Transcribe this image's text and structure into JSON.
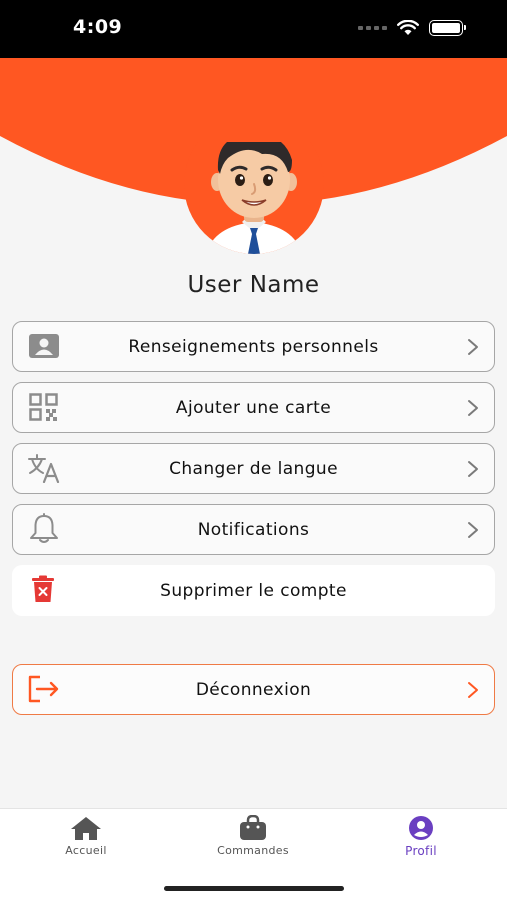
{
  "status_bar": {
    "time": "4:09"
  },
  "profile": {
    "user_name": "User Name"
  },
  "menu": [
    {
      "label": "Renseignements personnels",
      "icon": "id-card-icon"
    },
    {
      "label": "Ajouter une carte",
      "icon": "qr-code-icon"
    },
    {
      "label": "Changer de langue",
      "icon": "translate-icon"
    },
    {
      "label": "Notifications",
      "icon": "bell-icon"
    },
    {
      "label": "Supprimer le compte",
      "icon": "trash-icon"
    }
  ],
  "logout": {
    "label": "Déconnexion",
    "icon": "logout-icon"
  },
  "tabbar": [
    {
      "label": "Accueil",
      "icon": "home-icon",
      "active": false
    },
    {
      "label": "Commandes",
      "icon": "shopping-bag-icon",
      "active": false
    },
    {
      "label": "Profil",
      "icon": "profile-icon",
      "active": true
    }
  ],
  "colors": {
    "accent": "#ff5722",
    "active_tab": "#6a3fc1",
    "danger": "#e53935",
    "border": "#a6a6a6"
  }
}
